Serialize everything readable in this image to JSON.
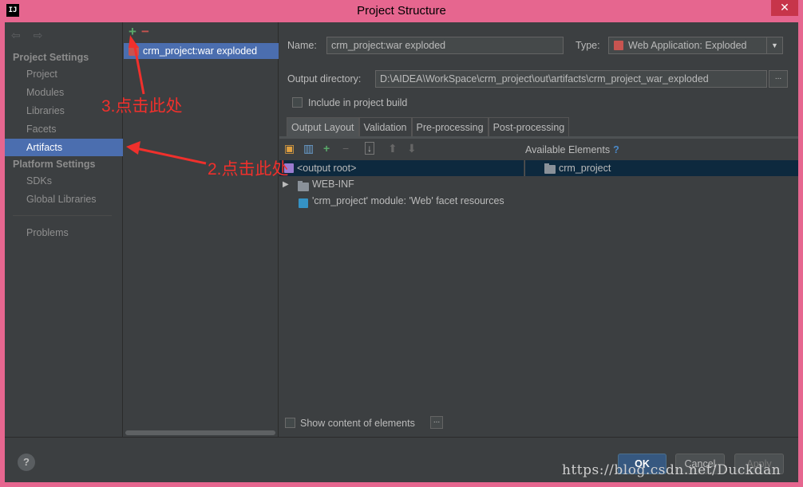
{
  "window": {
    "title": "Project Structure",
    "app_icon": "IJ",
    "close": "✕"
  },
  "sidebar": {
    "nav_arrows": "⇦ ⇨",
    "project_settings": "Project Settings",
    "items": [
      {
        "label": "Project"
      },
      {
        "label": "Modules"
      },
      {
        "label": "Libraries"
      },
      {
        "label": "Facets"
      },
      {
        "label": "Artifacts",
        "active": true
      }
    ],
    "platform_settings": "Platform Settings",
    "platform_items": [
      {
        "label": "SDKs"
      },
      {
        "label": "Global Libraries"
      }
    ],
    "problems": "Problems"
  },
  "artifacts": {
    "add": "+",
    "remove": "−",
    "items": [
      {
        "label": "crm_project:war exploded"
      }
    ]
  },
  "details": {
    "name_label": "Name:",
    "name_value": "crm_project:war exploded",
    "type_label": "Type:",
    "type_value": "Web Application: Exploded",
    "output_label": "Output directory:",
    "output_value": "D:\\AIDEA\\WorkSpace\\crm_project\\out\\artifacts\\crm_project_war_exploded",
    "dots": "...",
    "include_label": "Include in project build",
    "tabs": [
      {
        "label": "Output Layout",
        "active": true
      },
      {
        "label": "Validation"
      },
      {
        "label": "Pre-processing"
      },
      {
        "label": "Post-processing"
      }
    ],
    "available_label": "Available Elements",
    "available_help": "?",
    "tree": [
      {
        "label": "<output root>"
      },
      {
        "label": "WEB-INF"
      },
      {
        "label": "'crm_project' module: 'Web' facet resources"
      }
    ],
    "available_items": [
      {
        "label": "crm_project"
      }
    ],
    "show_content_label": "Show content of elements"
  },
  "footer": {
    "help": "?",
    "ok": "OK",
    "cancel": "Cancel",
    "apply": "Apply",
    "watermark": "https://blog.csdn.net/Duckdan"
  },
  "annotations": {
    "step2": "2.点击此处",
    "step3": "3.点击此处",
    "color": "#f0302c"
  }
}
